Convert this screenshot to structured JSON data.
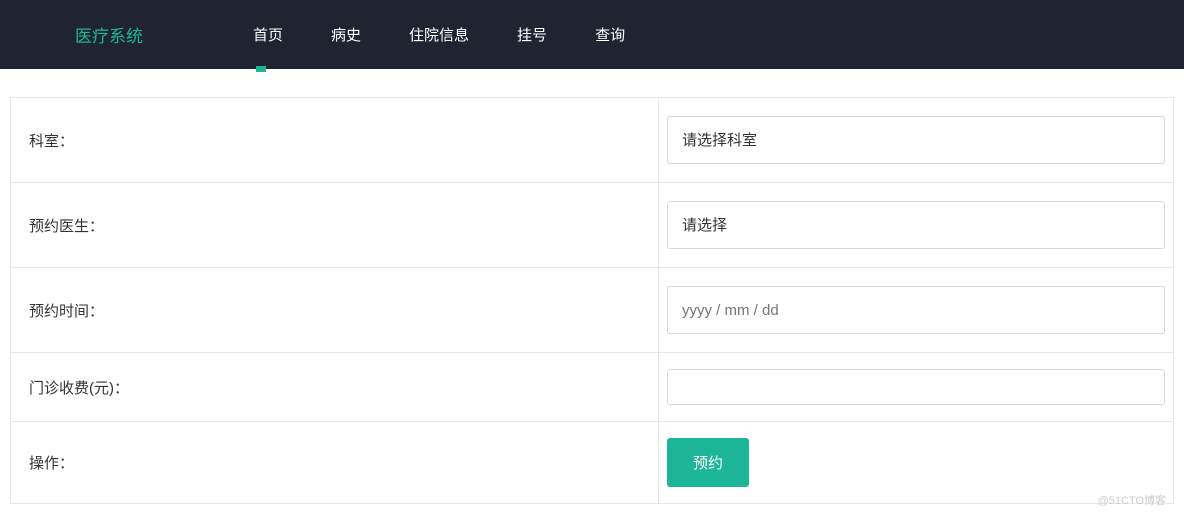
{
  "header": {
    "brand": "医疗系统",
    "nav": [
      {
        "label": "首页"
      },
      {
        "label": "病史"
      },
      {
        "label": "住院信息"
      },
      {
        "label": "挂号"
      },
      {
        "label": "查询"
      }
    ]
  },
  "form": {
    "department": {
      "label": "科室：",
      "placeholder": "请选择科室"
    },
    "doctor": {
      "label": "预约医生：",
      "placeholder": "请选择"
    },
    "time": {
      "label": "预约时间：",
      "placeholder": "yyyy / mm / dd"
    },
    "fee": {
      "label": "门诊收费(元)：",
      "value": ""
    },
    "action": {
      "label": "操作：",
      "submit": "预约"
    }
  },
  "footer": {
    "watermark": "@51CTO博客"
  }
}
